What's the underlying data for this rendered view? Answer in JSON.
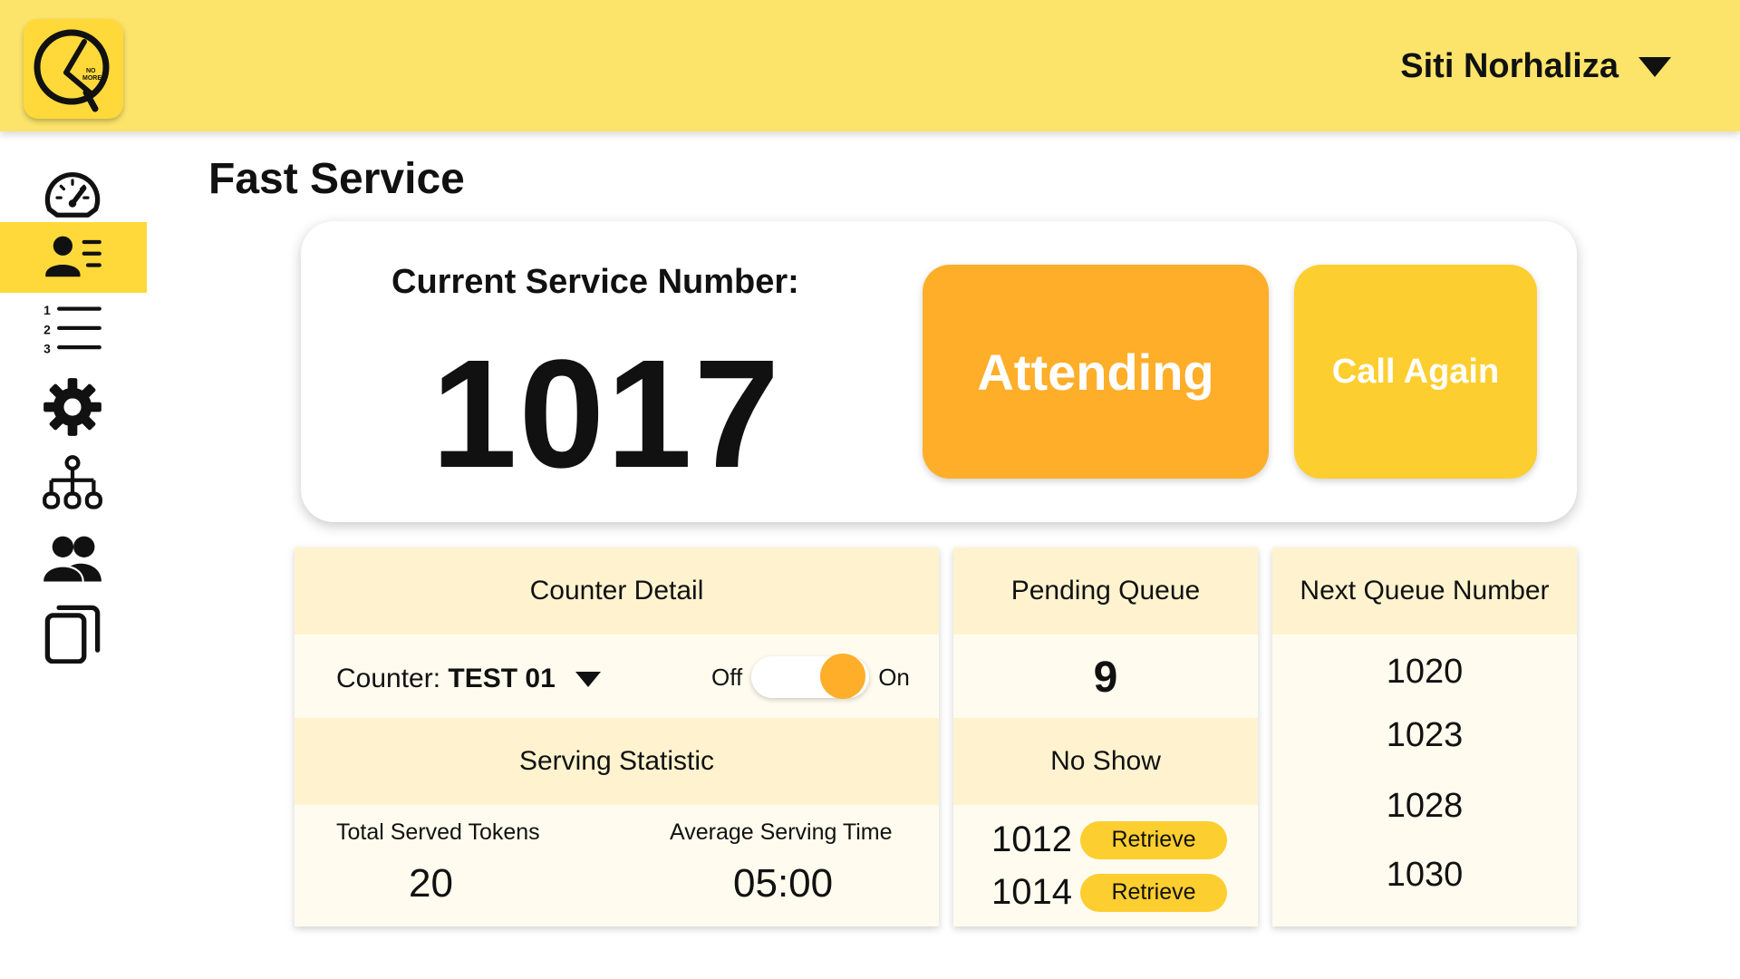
{
  "header": {
    "logo_text": [
      "NO",
      "MORE"
    ],
    "user_name": "Siti Norhaliza",
    "brand_color": "#fce46a"
  },
  "sidebar": {
    "items": [
      {
        "icon": "dashboard-gauge-icon",
        "active": false
      },
      {
        "icon": "user-list-icon",
        "active": true
      },
      {
        "icon": "numbered-list-icon",
        "active": false
      },
      {
        "icon": "gear-icon",
        "active": false
      },
      {
        "icon": "hierarchy-icon",
        "active": false
      },
      {
        "icon": "users-icon",
        "active": false
      },
      {
        "icon": "copy-icon",
        "active": false
      }
    ]
  },
  "page": {
    "title": "Fast Service"
  },
  "service": {
    "label": "Current Service Number:",
    "number": "1017",
    "attending_label": "Attending",
    "call_again_label": "Call Again"
  },
  "counter_detail": {
    "heading": "Counter Detail",
    "counter_prefix": "Counter:",
    "counter_value": "TEST 01",
    "toggle_off": "Off",
    "toggle_on": "On",
    "toggle_state": "on"
  },
  "serving_statistic": {
    "heading": "Serving Statistic",
    "total_label": "Total Served Tokens",
    "total_value": "20",
    "avg_label": "Average Serving Time",
    "avg_value": "05:00"
  },
  "pending_queue": {
    "heading": "Pending Queue",
    "count": "9"
  },
  "no_show": {
    "heading": "No Show",
    "items": [
      {
        "number": "1012",
        "action": "Retrieve"
      },
      {
        "number": "1014",
        "action": "Retrieve"
      }
    ]
  },
  "next_queue": {
    "heading": "Next Queue Number",
    "numbers": [
      "1020",
      "1023",
      "1028",
      "1030"
    ]
  }
}
